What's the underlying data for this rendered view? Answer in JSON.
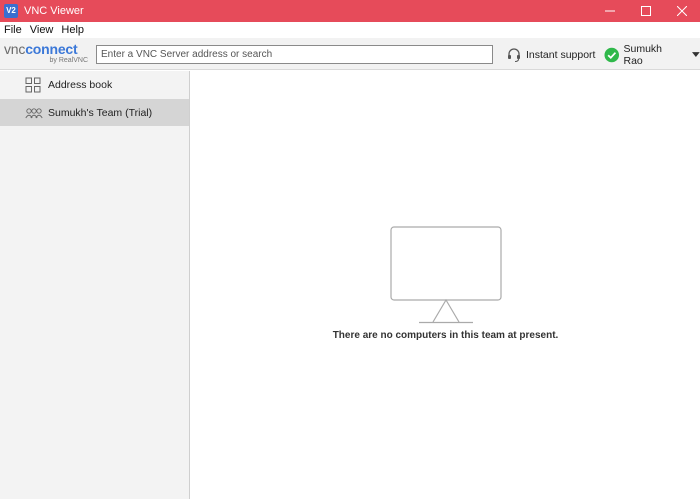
{
  "window": {
    "app_icon_text": "V2",
    "title": "VNC Viewer"
  },
  "menu": {
    "items": [
      "File",
      "View",
      "Help"
    ]
  },
  "toolbar": {
    "logo_vnc": "vnc",
    "logo_connect": "connect",
    "logo_sub": "by RealVNC",
    "search_placeholder": "Enter a VNC Server address or search",
    "search_value": "",
    "instant_support_label": "Instant support",
    "user_name": "Sumukh Rao",
    "status_color": "#2fb84a"
  },
  "sidebar": {
    "items": [
      {
        "label": "Address book",
        "icon": "grid-icon",
        "selected": false
      },
      {
        "label": "Sumukh's Team (Trial)",
        "icon": "team-icon",
        "selected": true
      }
    ]
  },
  "main": {
    "empty_message": "There are no computers in this team at present.",
    "icon": "monitor-icon"
  },
  "colors": {
    "titlebar": "#e64b5a",
    "accent": "#3b78d8",
    "selection": "#d5d5d5"
  }
}
